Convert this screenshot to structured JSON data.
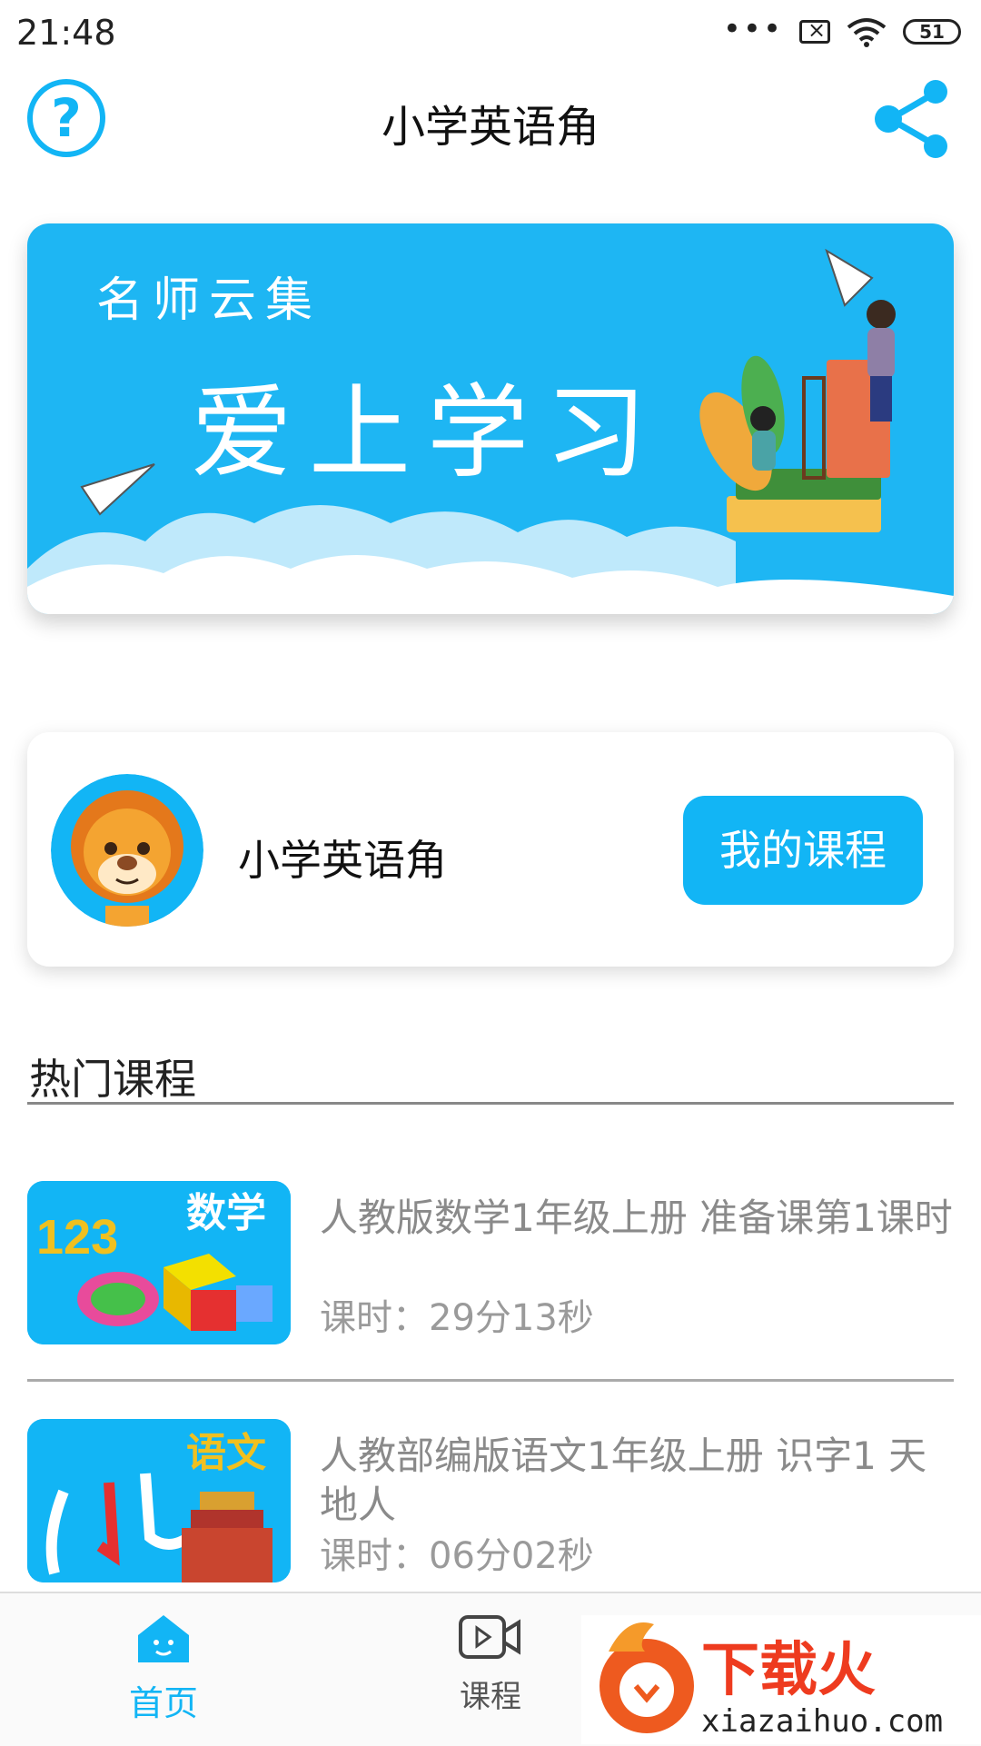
{
  "status_bar": {
    "time": "21:48",
    "battery": "51"
  },
  "app_bar": {
    "title": "小学英语角"
  },
  "banner": {
    "subtitle": "名师云集",
    "headline": "爱上学习"
  },
  "profile": {
    "name": "小学英语角",
    "my_courses_button": "我的课程"
  },
  "hot_courses": {
    "section_title": "热门课程",
    "items": [
      {
        "thumb_label": "数学",
        "thumb_digits": "123",
        "title": "人教版数学1年级上册 准备课第1课时",
        "duration": "课时：29分13秒"
      },
      {
        "thumb_label": "语文",
        "title": "人教部编版语文1年级上册 识字1 天地人",
        "duration": "课时：06分02秒"
      }
    ]
  },
  "bottom_nav": {
    "home": "首页",
    "courses": "课程"
  },
  "watermark": {
    "brand": "下载火",
    "url": "xiazaihuo.com"
  },
  "colors": {
    "accent": "#12b5f5"
  }
}
